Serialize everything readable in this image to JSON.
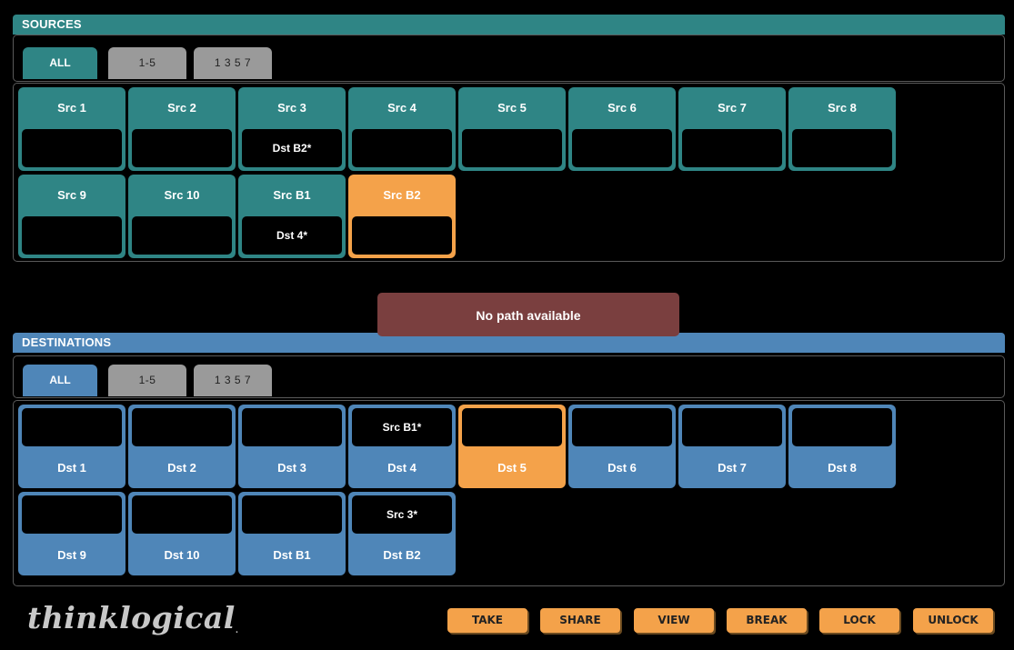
{
  "sources": {
    "header": "SOURCES",
    "tabs": [
      "ALL",
      "1-5",
      "1 3 5 7"
    ],
    "tiles": [
      {
        "name": "Src 1",
        "dest": ""
      },
      {
        "name": "Src 2",
        "dest": ""
      },
      {
        "name": "Src 3",
        "dest": "Dst B2*"
      },
      {
        "name": "Src 4",
        "dest": ""
      },
      {
        "name": "Src 5",
        "dest": ""
      },
      {
        "name": "Src 6",
        "dest": ""
      },
      {
        "name": "Src 7",
        "dest": ""
      },
      {
        "name": "Src 8",
        "dest": ""
      },
      {
        "name": "Src 9",
        "dest": ""
      },
      {
        "name": "Src 10",
        "dest": ""
      },
      {
        "name": "Src B1",
        "dest": "Dst 4*"
      },
      {
        "name": "Src B2",
        "dest": ""
      }
    ],
    "selected": "Src B2"
  },
  "destinations": {
    "header": "DESTINATIONS",
    "tabs": [
      "ALL",
      "1-5",
      "1 3 5 7"
    ],
    "tiles": [
      {
        "name": "Dst 1",
        "source": ""
      },
      {
        "name": "Dst 2",
        "source": ""
      },
      {
        "name": "Dst 3",
        "source": ""
      },
      {
        "name": "Dst 4",
        "source": "Src B1*"
      },
      {
        "name": "Dst 5",
        "source": ""
      },
      {
        "name": "Dst 6",
        "source": ""
      },
      {
        "name": "Dst 7",
        "source": ""
      },
      {
        "name": "Dst 8",
        "source": ""
      },
      {
        "name": "Dst 9",
        "source": ""
      },
      {
        "name": "Dst 10",
        "source": ""
      },
      {
        "name": "Dst B1",
        "source": ""
      },
      {
        "name": "Dst B2",
        "source": "Src 3*"
      }
    ],
    "selected": "Dst 5"
  },
  "toast": "No path available",
  "logo": "thinklogical",
  "logo_mark": ".",
  "actions": [
    "TAKE",
    "SHARE",
    "VIEW",
    "BREAK",
    "LOCK",
    "UNLOCK"
  ],
  "colors": {
    "source_accent": "#2f8585",
    "destination_accent": "#4f86b8",
    "selected": "#f4a24a",
    "toast_bg": "#7a3f3f"
  }
}
